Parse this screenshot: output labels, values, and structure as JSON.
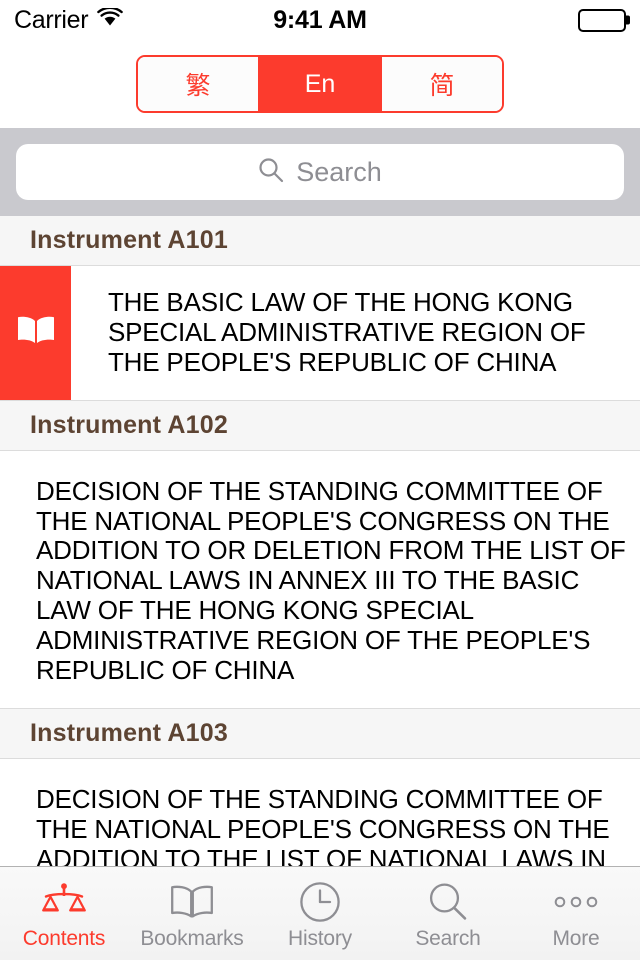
{
  "status_bar": {
    "carrier": "Carrier",
    "wifi_icon": "wifi-icon",
    "time": "9:41 AM",
    "battery_icon": "battery-full-icon"
  },
  "language_switcher": {
    "name": "language-segmented-control",
    "options": [
      {
        "label": "繁",
        "value": "traditional",
        "selected": false
      },
      {
        "label": "En",
        "value": "english",
        "selected": true
      },
      {
        "label": "简",
        "value": "simplified",
        "selected": false
      }
    ]
  },
  "search": {
    "placeholder": "Search",
    "value": "",
    "icon": "search-icon"
  },
  "list": {
    "sections": [
      {
        "header": "Instrument A101",
        "item": {
          "icon": "open-book-icon",
          "has_icon": true,
          "title": "THE BASIC LAW OF THE HONG KONG SPECIAL ADMINISTRATIVE REGION OF THE PEOPLE'S REPUBLIC OF CHINA"
        }
      },
      {
        "header": "Instrument A102",
        "item": {
          "icon": "",
          "has_icon": false,
          "title": "DECISION OF THE STANDING COMMITTEE OF THE NATIONAL PEOPLE'S CONGRESS ON THE ADDITION TO OR DELETION FROM THE LIST OF NATIONAL LAWS IN ANNEX III TO THE BASIC LAW OF THE HONG KONG SPECIAL ADMINISTRATIVE REGION OF THE PEOPLE'S REPUBLIC OF CHINA"
        }
      },
      {
        "header": "Instrument A103",
        "item": {
          "icon": "",
          "has_icon": false,
          "title": "DECISION OF THE STANDING COMMITTEE OF THE NATIONAL PEOPLE'S CONGRESS ON THE ADDITION TO THE LIST OF NATIONAL LAWS IN"
        }
      }
    ]
  },
  "tab_bar": {
    "tabs": [
      {
        "label": "Contents",
        "icon": "scales-of-justice-icon",
        "active": true
      },
      {
        "label": "Bookmarks",
        "icon": "open-book-icon",
        "active": false
      },
      {
        "label": "History",
        "icon": "clock-icon",
        "active": false
      },
      {
        "label": "Search",
        "icon": "search-icon",
        "active": false
      },
      {
        "label": "More",
        "icon": "ellipsis-icon",
        "active": false
      }
    ]
  },
  "colors": {
    "accent": "#fc3b2d",
    "section_header_text": "#5d4433",
    "search_bar_bg": "#c9c9ce",
    "inactive_tab": "#8e8e93"
  }
}
